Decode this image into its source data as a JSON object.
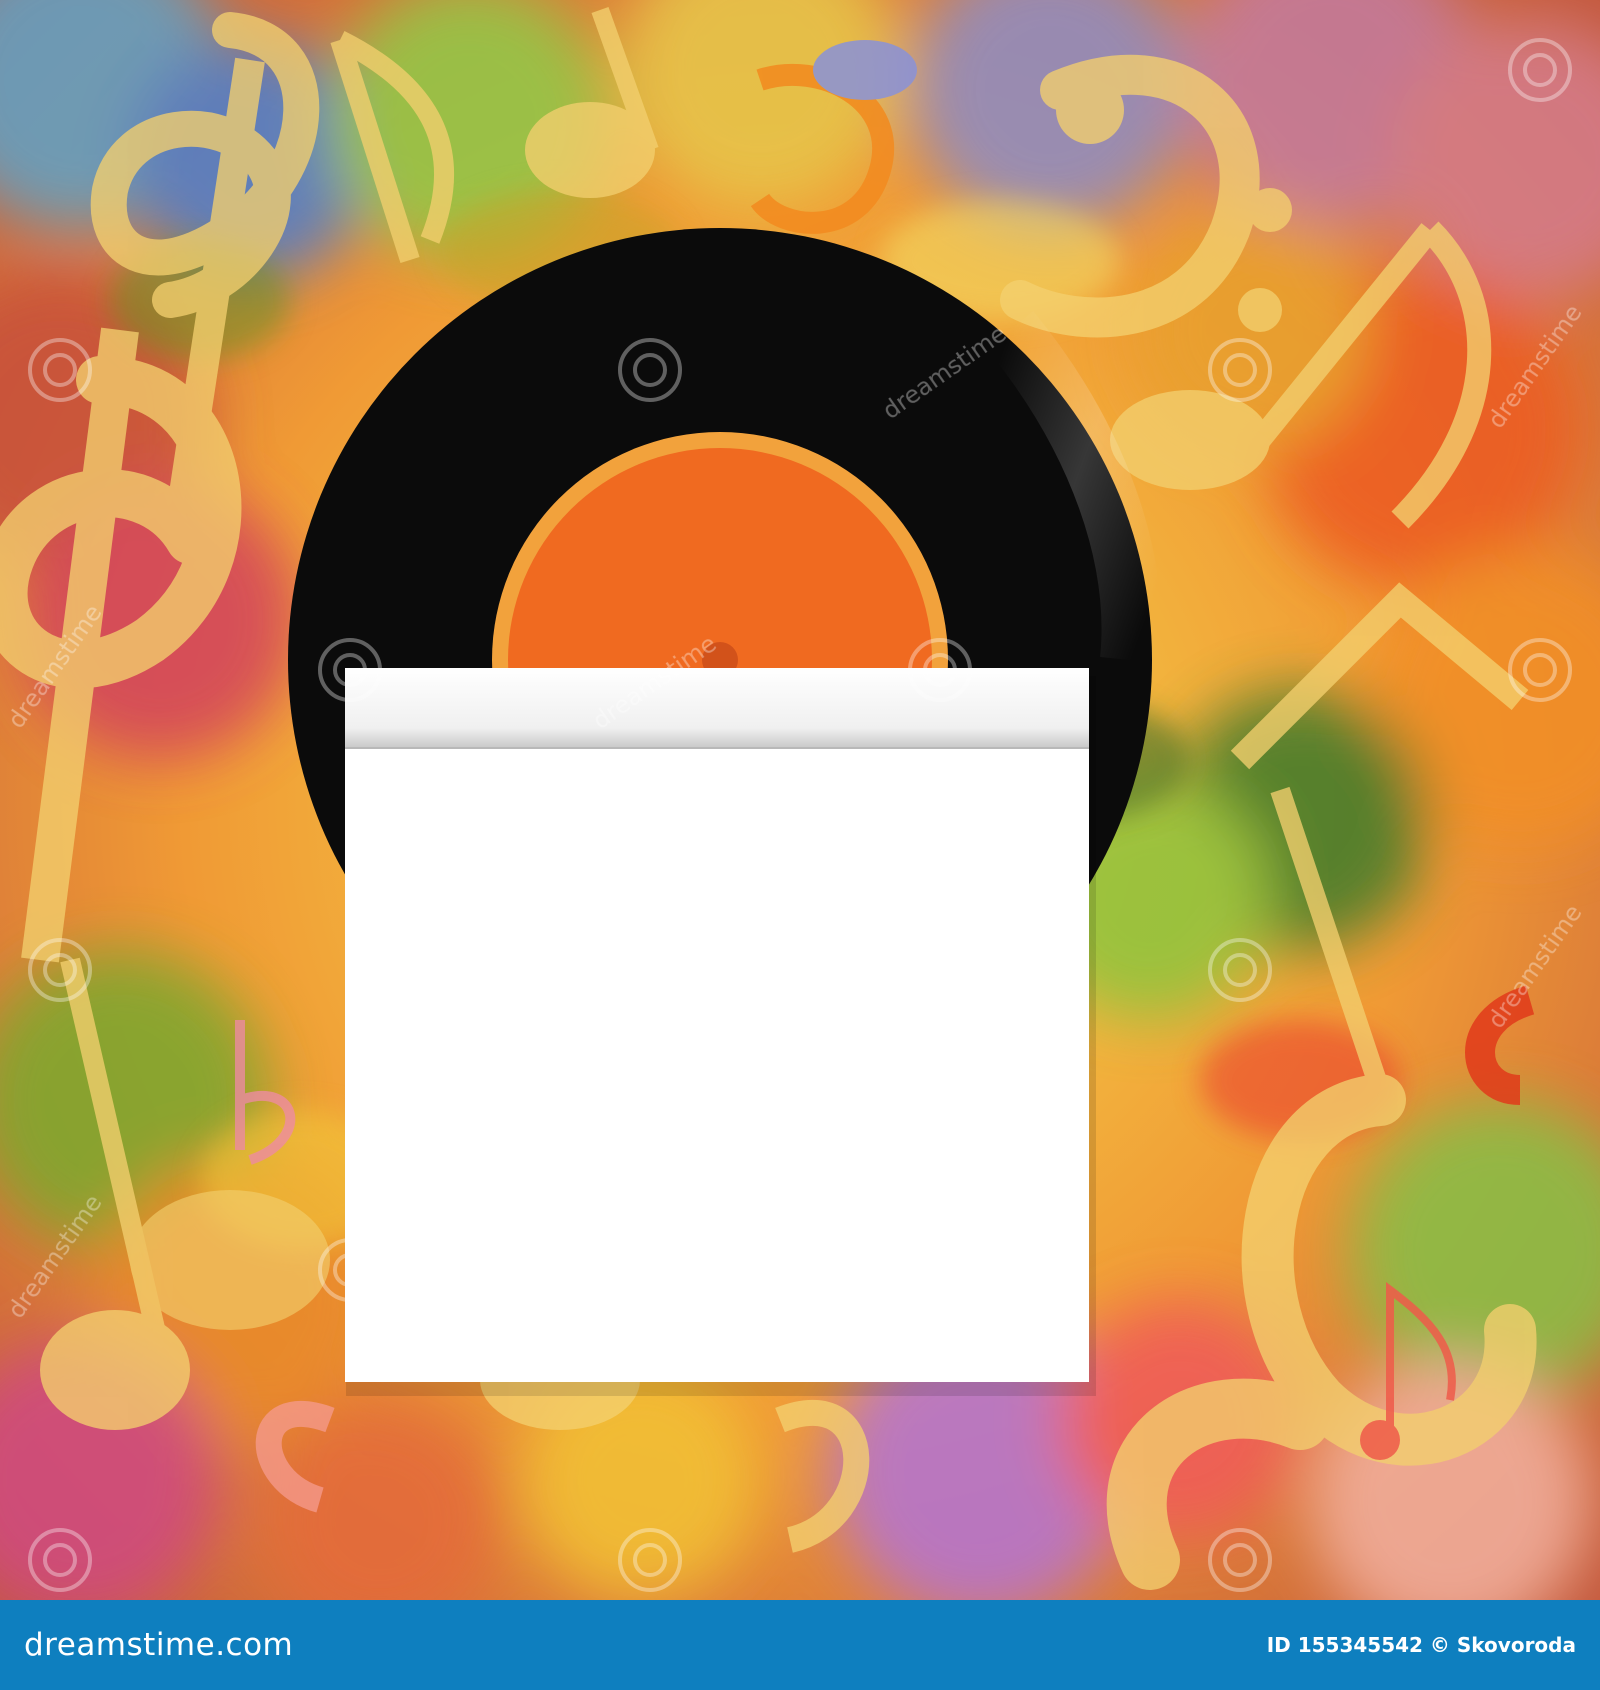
{
  "image": {
    "kind": "music-themed vinyl record album cover mockup",
    "colors": {
      "record": "#0b0b0b",
      "label_ring": "#f2a23c",
      "label": "#f06a20",
      "sleeve": "#ffffff",
      "footer_bar": "#0e7fbf",
      "notes": "#f3cf6e"
    }
  },
  "watermark": {
    "text": "dreamstime"
  },
  "footer": {
    "brand": "dreamstime.com",
    "image_id": "ID 155345542",
    "credit": "© Skovoroda"
  }
}
